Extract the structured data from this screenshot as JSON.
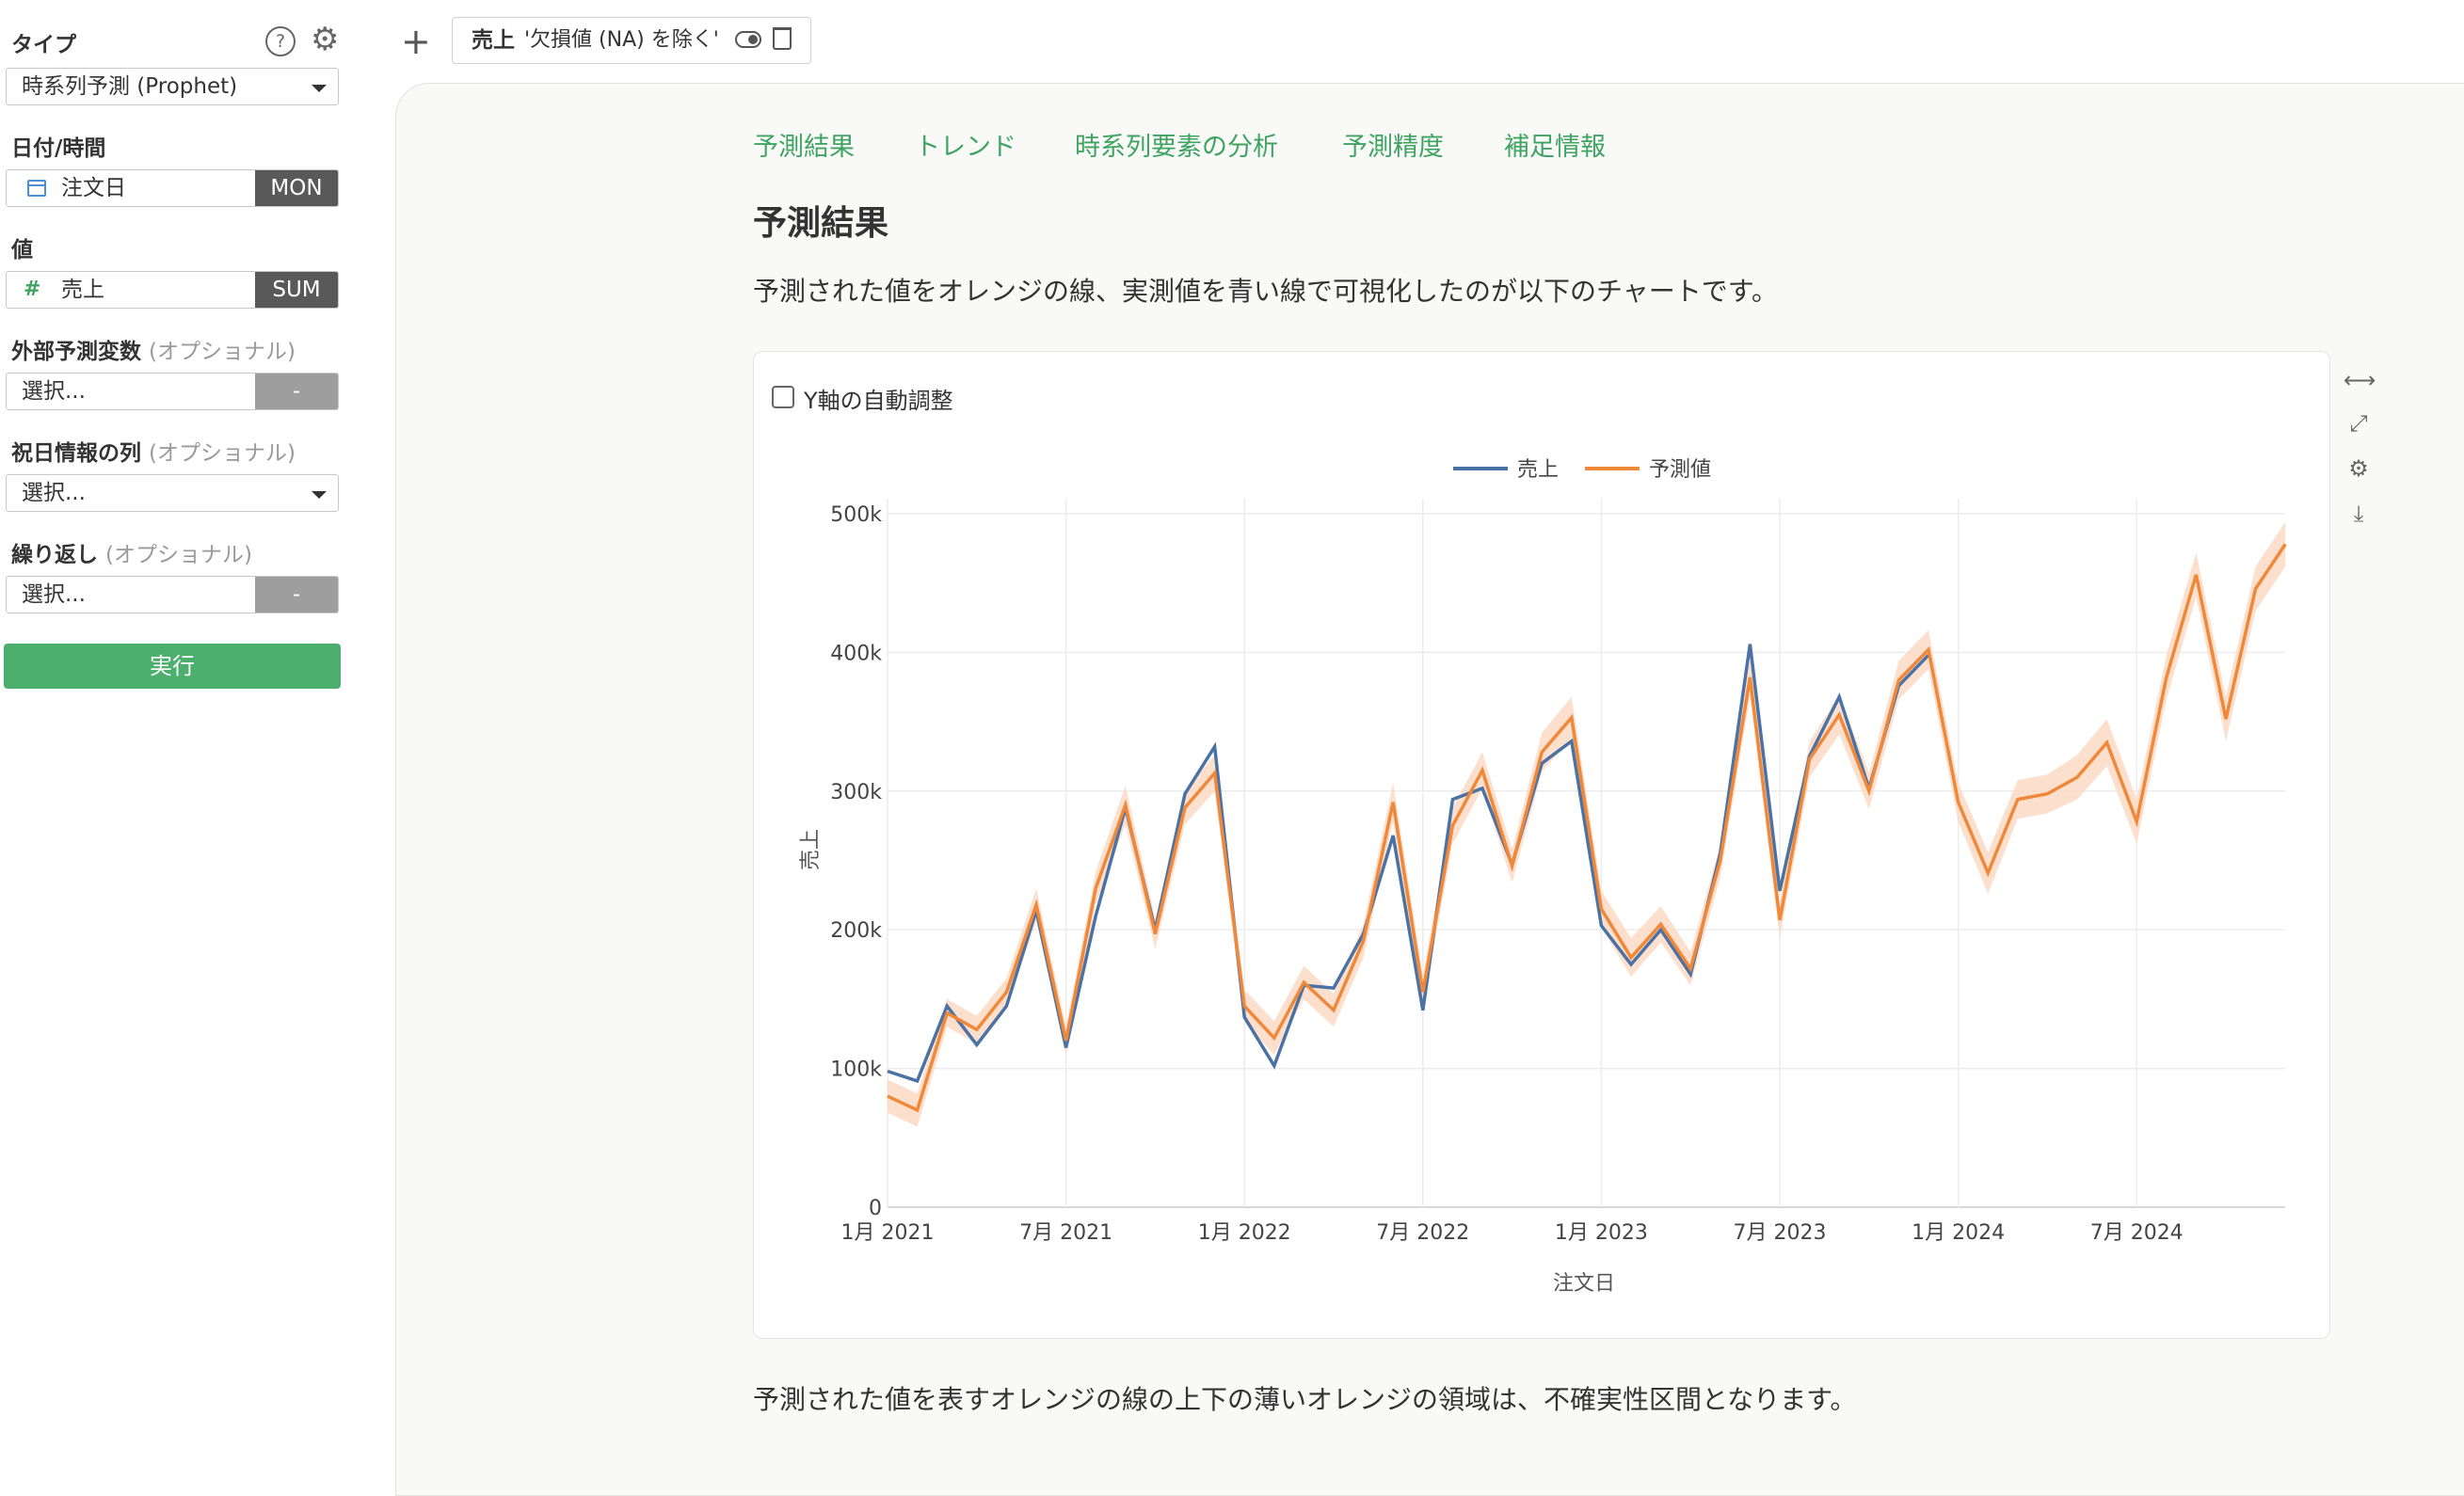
{
  "sidebar": {
    "type_label": "タイプ",
    "type_value": "時系列予測 (Prophet)",
    "date_label": "日付/時間",
    "date_field": "注文日",
    "date_agg": "MON",
    "value_label": "値",
    "value_icon": "#",
    "value_field": "売上",
    "value_agg": "SUM",
    "external_label": "外部予測変数",
    "holiday_label": "祝日情報の列",
    "repeat_label": "繰り返し",
    "optional": "(オプショナル)",
    "select_placeholder": "選択...",
    "dash": "-",
    "help": "?",
    "run_button": "実行"
  },
  "topbar": {
    "plus": "+",
    "filter_col": "売上",
    "filter_text": "'欠損値 (NA) を除く'"
  },
  "tabs": [
    "予測結果",
    "トレンド",
    "時系列要素の分析",
    "予測精度",
    "補足情報"
  ],
  "section_title": "予測結果",
  "intro_text": "予測された値をオレンジの線、実測値を青い線で可視化したのが以下のチャートです。",
  "checkbox_label": "Y軸の自動調整",
  "footer_text": "予測された値を表すオレンジの線の上下の薄いオレンジの領域は、不確実性区間となります。",
  "colors": {
    "actual": "#4a72a5",
    "forecast": "#f0883a",
    "band": "#fbd9c3",
    "accent": "#4caf6e",
    "tab": "#3fa461"
  },
  "chart_data": {
    "type": "line",
    "xlabel": "注文日",
    "ylabel": "売上",
    "ylim": [
      0,
      500000
    ],
    "y_ticks": [
      0,
      100000,
      200000,
      300000,
      400000,
      500000
    ],
    "y_tick_labels": [
      "0",
      "100k",
      "200k",
      "300k",
      "400k",
      "500k"
    ],
    "x_tick_labels": [
      "1月 2021",
      "7月 2021",
      "1月 2022",
      "7月 2022",
      "1月 2023",
      "7月 2023",
      "1月 2024",
      "7月 2024"
    ],
    "x_tick_months": [
      0,
      6,
      12,
      18,
      24,
      30,
      36,
      42
    ],
    "x_months": [
      0,
      1,
      2,
      3,
      4,
      5,
      6,
      7,
      8,
      9,
      10,
      11,
      12,
      13,
      14,
      15,
      16,
      17,
      18,
      19,
      20,
      21,
      22,
      23,
      24,
      25,
      26,
      27,
      28,
      29,
      30,
      31,
      32,
      33,
      34,
      35,
      36,
      37,
      38,
      39,
      40,
      41,
      42,
      43,
      44,
      45,
      46,
      47
    ],
    "legend": [
      "売上",
      "予測値"
    ],
    "legend_placement": "top-center",
    "grid": true,
    "series": [
      {
        "name": "売上",
        "values": [
          98000,
          91000,
          145000,
          117000,
          145000,
          214000,
          115000,
          210000,
          288000,
          200000,
          298000,
          332000,
          137000,
          102000,
          160000,
          158000,
          197000,
          268000,
          142000,
          294000,
          302000,
          247000,
          320000,
          336000,
          203000,
          175000,
          200000,
          168000,
          255000,
          406000,
          228000,
          325000,
          368000,
          302000,
          376000,
          398000
        ]
      },
      {
        "name": "予測値",
        "values": [
          80000,
          70000,
          140000,
          128000,
          155000,
          218000,
          120000,
          230000,
          290000,
          197000,
          288000,
          313000,
          145000,
          122000,
          162000,
          142000,
          192000,
          292000,
          155000,
          275000,
          315000,
          246000,
          328000,
          353000,
          215000,
          180000,
          204000,
          172000,
          250000,
          382000,
          207000,
          323000,
          355000,
          300000,
          380000,
          402000,
          292000,
          241000,
          294000,
          298000,
          310000,
          335000,
          278000,
          382000,
          456000,
          352000,
          446000,
          478000
        ],
        "lower": [
          68000,
          58000,
          130000,
          118000,
          145000,
          206000,
          110000,
          218000,
          276000,
          186000,
          276000,
          300000,
          133000,
          110000,
          150000,
          130000,
          180000,
          278000,
          143000,
          262000,
          302000,
          234000,
          314000,
          338000,
          202000,
          166000,
          191000,
          160000,
          238000,
          368000,
          194000,
          310000,
          341000,
          287000,
          366000,
          388000,
          278000,
          226000,
          280000,
          284000,
          294000,
          318000,
          262000,
          366000,
          440000,
          336000,
          430000,
          462000
        ],
        "upper": [
          92000,
          82000,
          150000,
          138000,
          165000,
          230000,
          130000,
          242000,
          304000,
          208000,
          300000,
          326000,
          157000,
          134000,
          174000,
          154000,
          204000,
          306000,
          167000,
          288000,
          328000,
          258000,
          342000,
          368000,
          228000,
          194000,
          217000,
          184000,
          262000,
          396000,
          220000,
          336000,
          369000,
          313000,
          394000,
          416000,
          306000,
          256000,
          308000,
          312000,
          326000,
          352000,
          294000,
          398000,
          472000,
          368000,
          462000,
          494000
        ]
      }
    ]
  }
}
